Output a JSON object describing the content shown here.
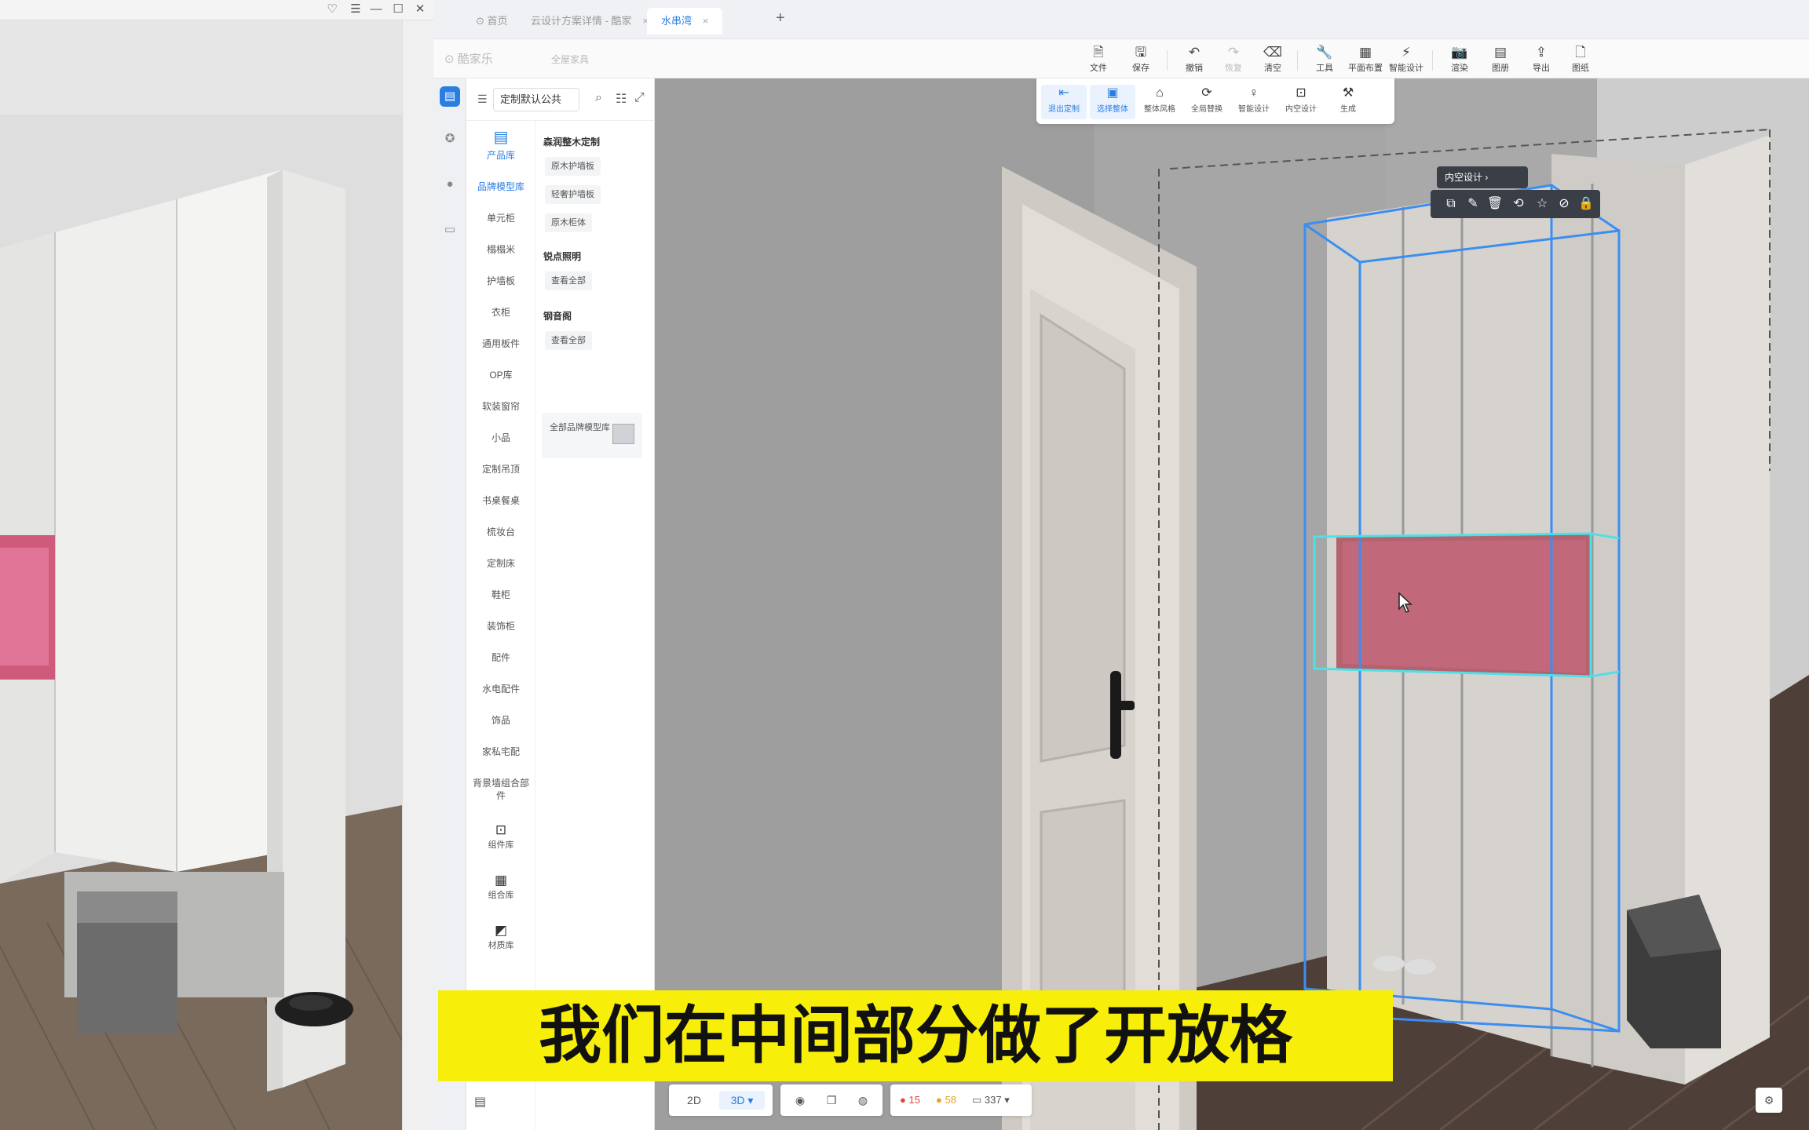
{
  "ref_window": {
    "controls": {
      "shirt": "♡",
      "menu": "☰",
      "minimize": "—",
      "maximize": "☐",
      "close": "✕"
    }
  },
  "tabs": [
    {
      "label": "首页",
      "icon": "⊙"
    },
    {
      "label": "云设计方案详情 - 酷家",
      "close": "×"
    },
    {
      "label": "水串湾",
      "close": "×",
      "active": true
    }
  ],
  "tab_add": "+",
  "header": {
    "logo": "⊙ 酷家乐",
    "logo_sub": "全屋家具",
    "tools": [
      {
        "label": "文件",
        "icon": "🗎"
      },
      {
        "label": "保存",
        "icon": "🖫"
      },
      {
        "label": "撤销",
        "icon": "↶"
      },
      {
        "label": "恢复",
        "icon": "↷",
        "disabled": true
      },
      {
        "label": "清空",
        "icon": "⌫"
      },
      {
        "label": "工具",
        "icon": "🔧"
      },
      {
        "label": "平面布置",
        "icon": "▦"
      },
      {
        "label": "智能设计",
        "icon": "⚡"
      },
      {
        "label": "渲染",
        "icon": "📷"
      },
      {
        "label": "图册",
        "icon": "▤"
      },
      {
        "label": "导出",
        "icon": "⇪"
      },
      {
        "label": "图纸",
        "icon": "🗋"
      }
    ]
  },
  "sub_toolbar": [
    {
      "label": "退出定制",
      "icon": "⇤",
      "active": true
    },
    {
      "label": "选择整体",
      "icon": "▣",
      "active": true
    },
    {
      "label": "整体风格",
      "icon": "⌂"
    },
    {
      "label": "全局替换",
      "icon": "⟳"
    },
    {
      "label": "智能设计",
      "icon": "♀"
    },
    {
      "label": "内空设计",
      "icon": "⊡"
    },
    {
      "label": "生成",
      "icon": "⚒"
    }
  ],
  "library": {
    "select_value": "定制默认公共",
    "category_head": {
      "label": "产品库",
      "icon": "▤"
    },
    "categories": [
      "品牌模型库",
      "单元柜",
      "榻榻米",
      "护墙板",
      "衣柜",
      "通用板件",
      "OP库",
      "软装窗帘",
      "小品",
      "定制吊顶",
      "书桌餐桌",
      "梳妆台",
      "定制床",
      "鞋柜",
      "装饰柜",
      "配件",
      "水电配件",
      "饰品",
      "家私宅配",
      "背景墙组合部件"
    ],
    "big_items": [
      {
        "label": "组件库",
        "icon": "⊡"
      },
      {
        "label": "组合库",
        "icon": "▦"
      },
      {
        "label": "材质库",
        "icon": "◩"
      }
    ],
    "groups": [
      {
        "title": "森润整木定制",
        "chips": [
          "原木护墙板",
          "轻奢护墙板",
          "原木柜体"
        ]
      },
      {
        "title": "锐点照明",
        "chips": [
          "查看全部"
        ]
      },
      {
        "title": "钢音阁",
        "chips": [
          "查看全部"
        ]
      }
    ],
    "all_card": "全部品牌模型库"
  },
  "inner_design_pill": "内空设计  ›",
  "float_toolbar_icons": [
    "copy-icon",
    "brush-icon",
    "delete-icon",
    "replace-icon",
    "star-icon",
    "hide-icon",
    "lock-icon"
  ],
  "subtitle": "我们在中间部分做了开放格",
  "bottom_bar": {
    "view_2d": "2D",
    "view_3d": "3D ▾",
    "errors": "15",
    "warnings": "58",
    "count": "337"
  },
  "colors": {
    "accent": "#2a7de1",
    "open_shelf": "#c1687b",
    "subtitle_bg": "#f7ef0a",
    "selection_box": "#3b8ef0"
  }
}
